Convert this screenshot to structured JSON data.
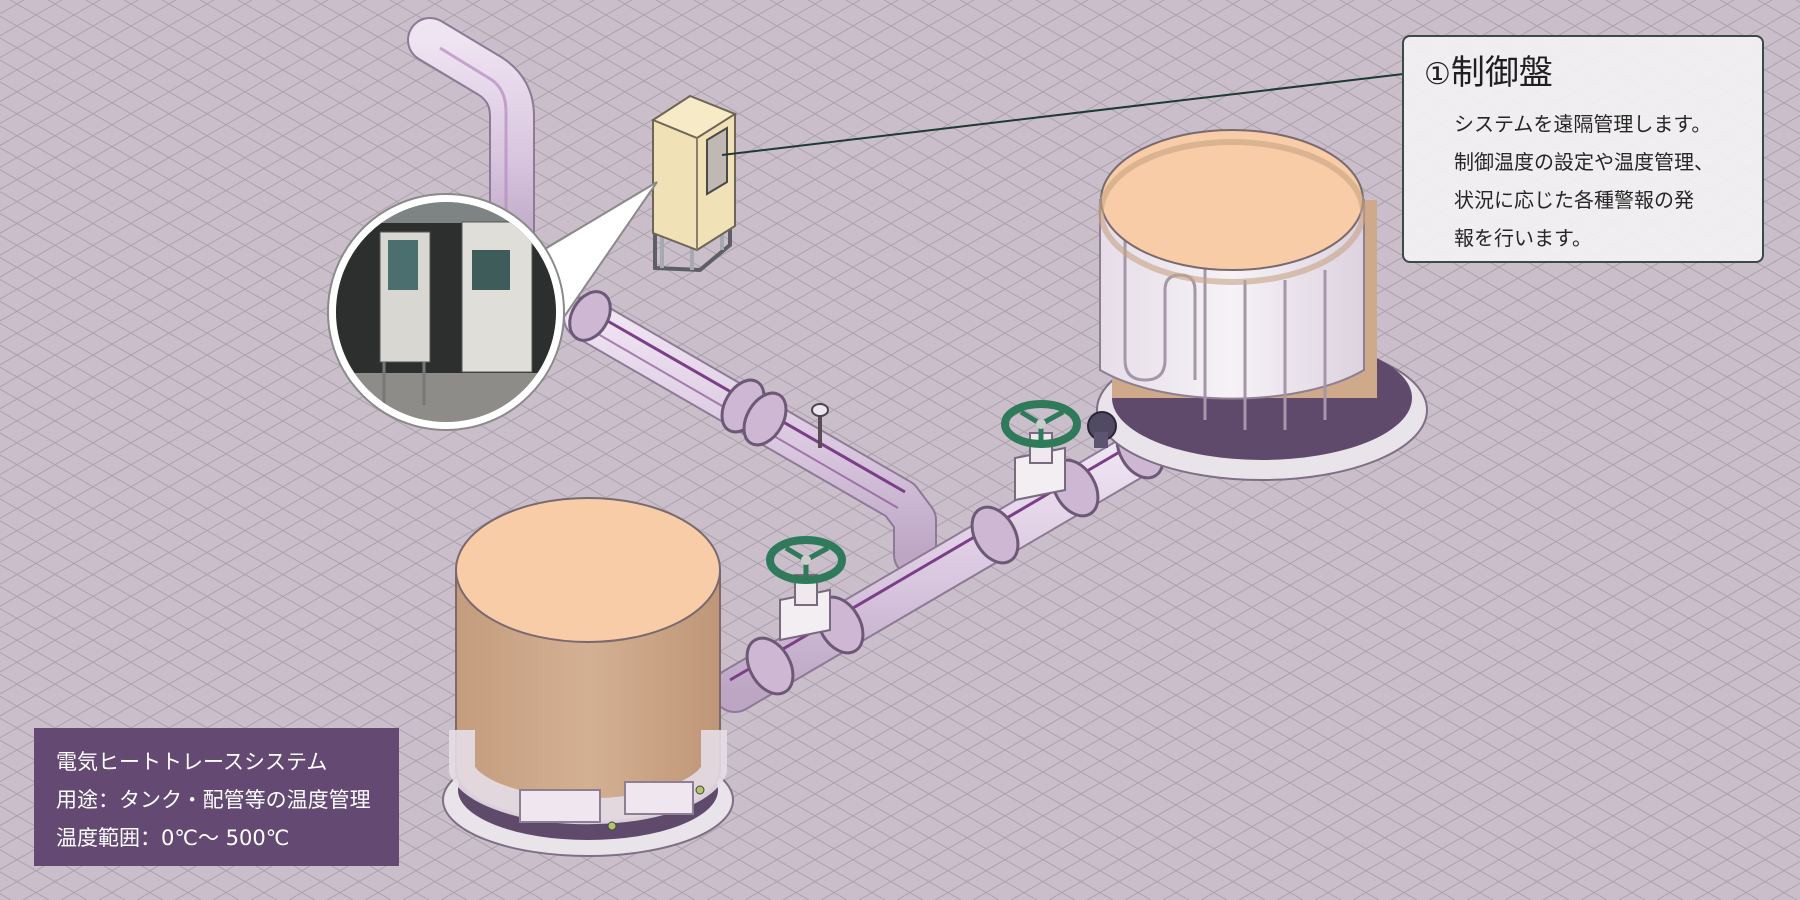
{
  "callout": {
    "number": "①",
    "title": "制御盤",
    "lines": [
      "システムを遠隔管理します。",
      "制御温度の設定や温度管理、",
      "状況に応じた各種警報の発",
      "報を行います。"
    ]
  },
  "info": {
    "system": "電気ヒートトレースシステム",
    "usage": "用途：タンク・配管等の温度管理",
    "range": "温度範囲：0℃～ 500℃"
  },
  "colors": {
    "background": "#c9bec9",
    "grid": "#a99fab",
    "tank_top": "#f8cca6",
    "tank_body_bare": "#cea98a",
    "heater_panel": "#efe6ef",
    "pipe": "#ddcbe3",
    "heat_trace_line": "#7a3f86",
    "valve_wheel": "#2f7a5a",
    "control_panel": "#f3e6bf",
    "info_box": "#644a72",
    "callout_border": "#3a4b45"
  }
}
